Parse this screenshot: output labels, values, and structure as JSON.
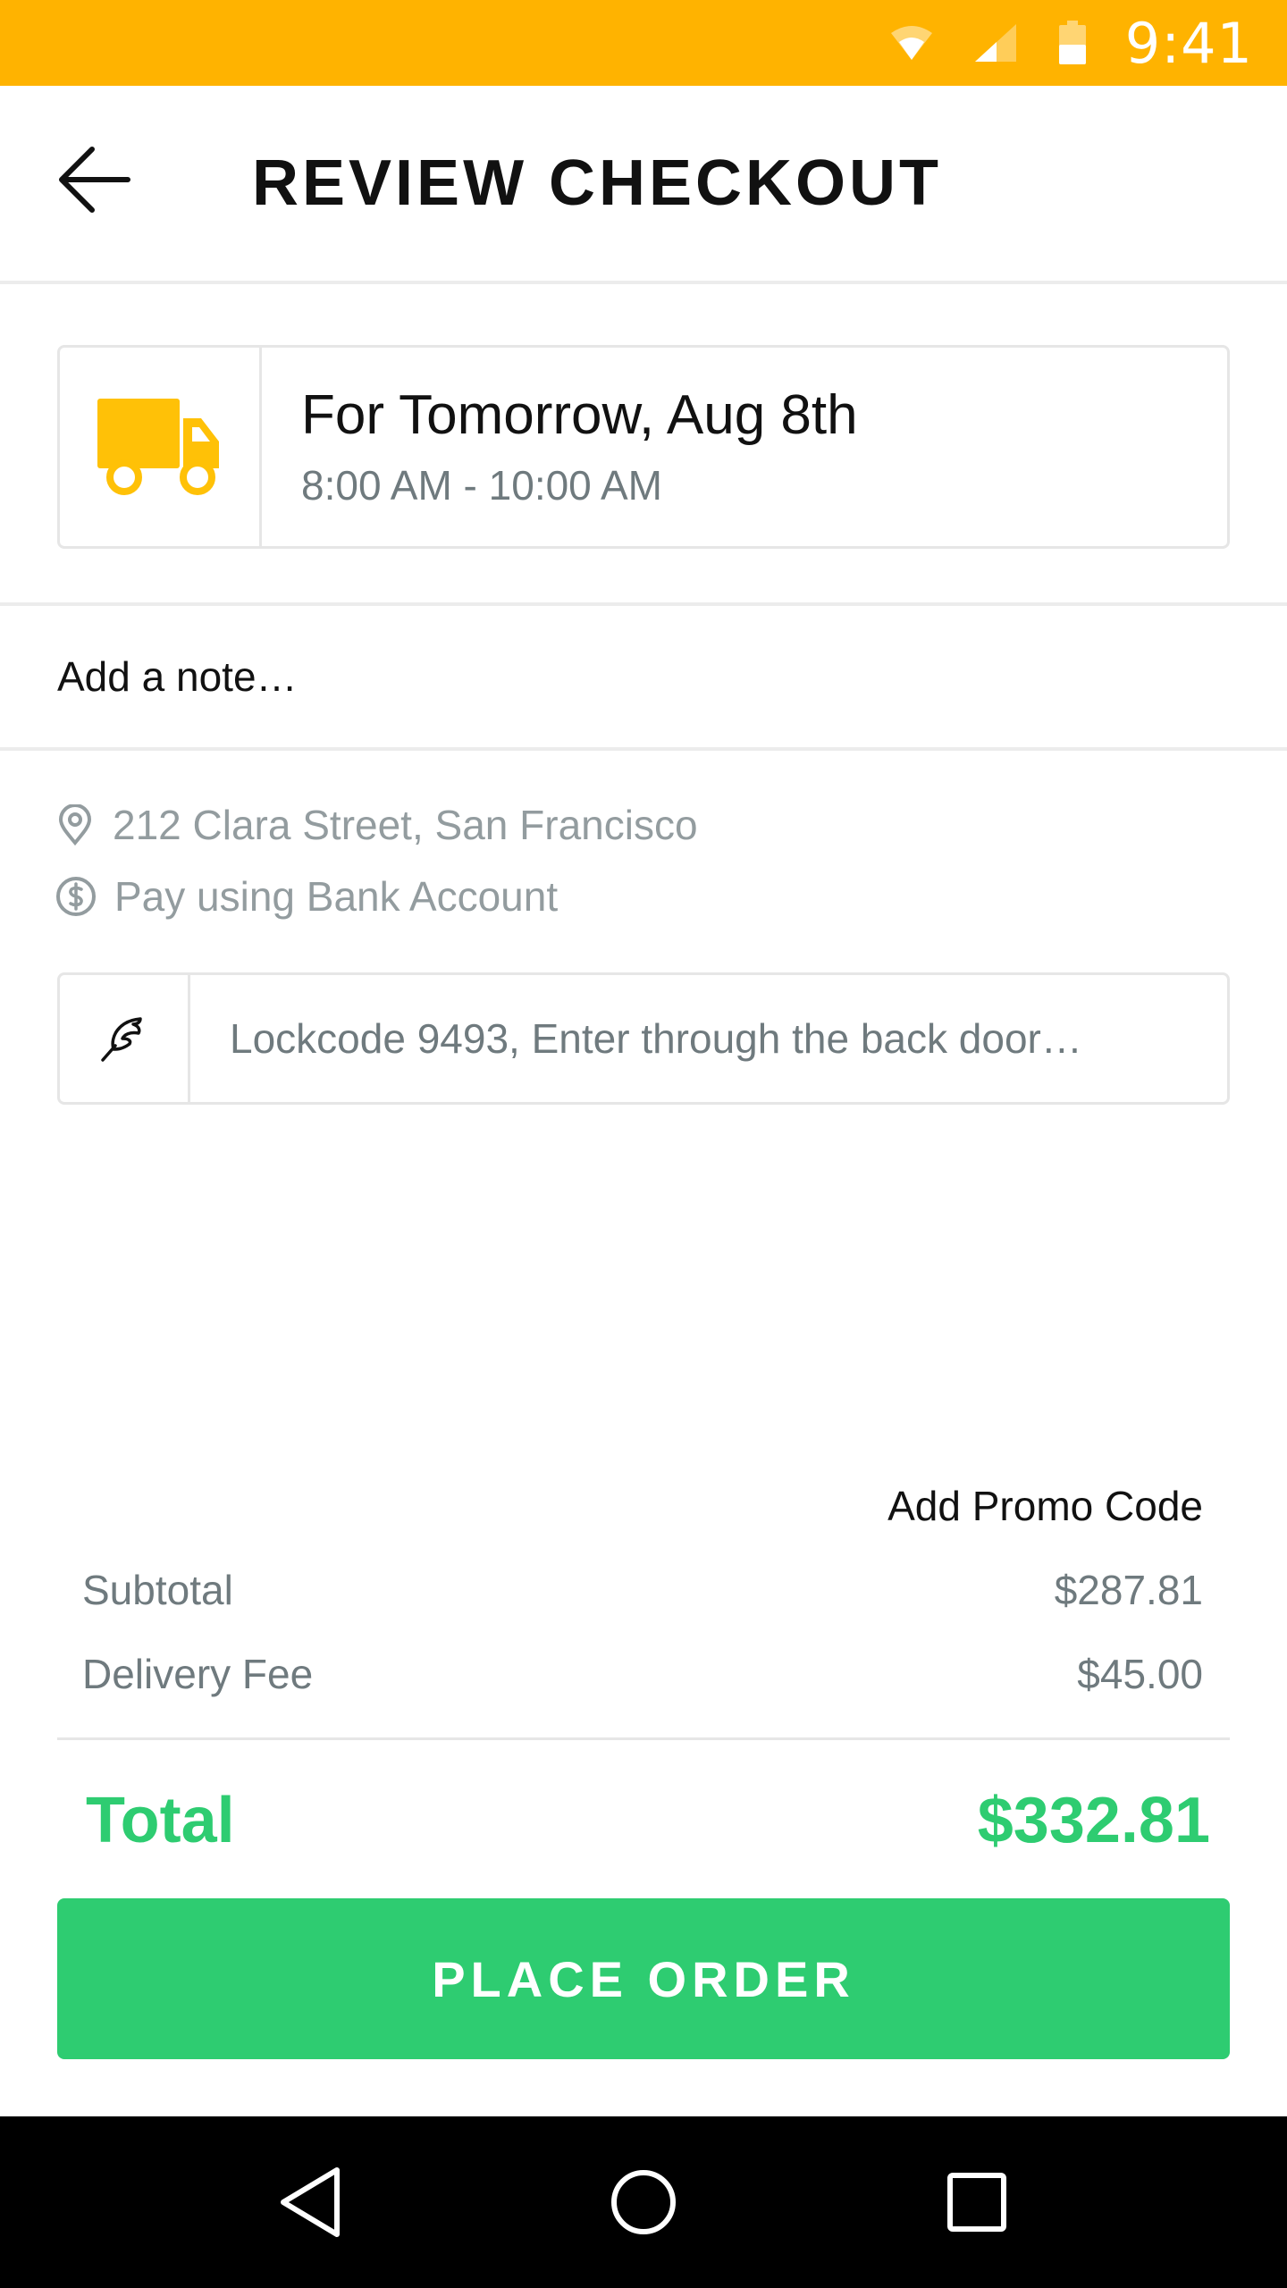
{
  "status_bar": {
    "time": "9:41",
    "background": "#FFB300",
    "icons": [
      "wifi-icon",
      "signal-icon",
      "battery-icon"
    ]
  },
  "header": {
    "title": "REVIEW CHECKOUT",
    "back_icon": "arrow-left-icon"
  },
  "delivery": {
    "icon": "truck-icon",
    "date": "For Tomorrow, Aug 8th",
    "window": "8:00 AM - 10:00 AM",
    "icon_color": "#FFC107"
  },
  "note": {
    "label": "Add a note…"
  },
  "address": {
    "icon": "location-pin-icon",
    "text": "212 Clara Street, San Francisco"
  },
  "payment": {
    "icon": "dollar-circle-icon",
    "text": "Pay using Bank Account"
  },
  "instructions": {
    "icon": "feather-icon",
    "placeholder": "Lockcode 9493, Enter through the back door…",
    "value": ""
  },
  "summary": {
    "promo_label": "Add Promo Code",
    "subtotal_label": "Subtotal",
    "subtotal_value": "$287.81",
    "fee_label": "Delivery Fee",
    "fee_value": "$45.00",
    "total_label": "Total",
    "total_value": "$332.81",
    "accent_color": "#2ECC71"
  },
  "actions": {
    "place_order_label": "PLACE ORDER"
  },
  "nav_bar": {
    "icons": [
      "nav-back-icon",
      "nav-home-icon",
      "nav-recents-icon"
    ]
  }
}
